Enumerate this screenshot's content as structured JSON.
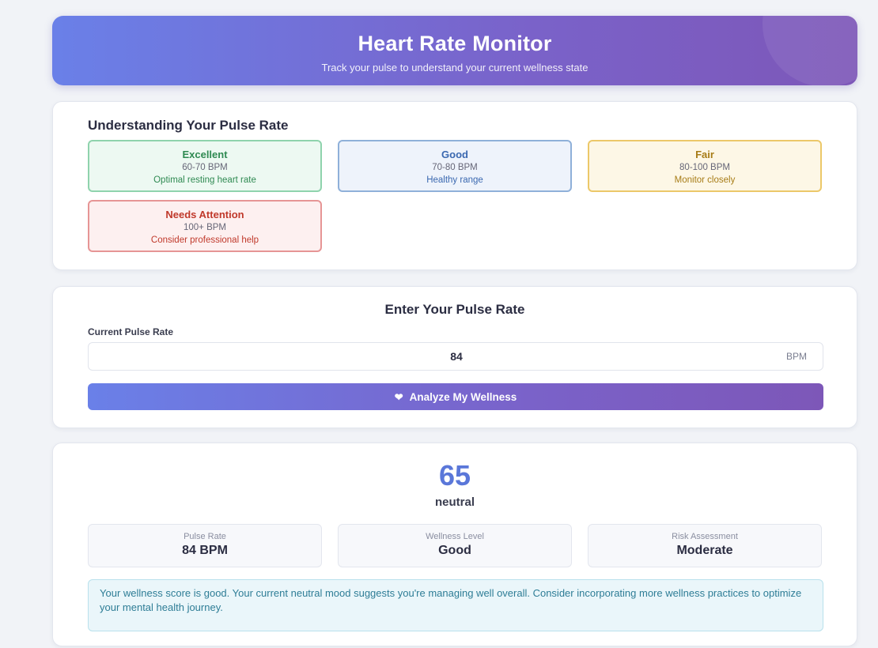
{
  "header": {
    "title": "Heart Rate Monitor",
    "subtitle": "Track your pulse to understand your current wellness state"
  },
  "understanding": {
    "title": "Understanding Your Pulse Rate",
    "ranges": [
      {
        "name": "Excellent",
        "bpm": "60-70 BPM",
        "description": "Optimal resting heart rate"
      },
      {
        "name": "Good",
        "bpm": "70-80 BPM",
        "description": "Healthy range"
      },
      {
        "name": "Fair",
        "bpm": "80-100 BPM",
        "description": "Monitor closely"
      },
      {
        "name": "Needs Attention",
        "bpm": "100+ BPM",
        "description": "Consider professional help"
      }
    ]
  },
  "entry": {
    "title": "Enter Your Pulse Rate",
    "field_label": "Current Pulse Rate",
    "value": "84",
    "unit": "BPM",
    "button_label": "Analyze My Wellness",
    "button_icon": "heart-icon"
  },
  "result": {
    "score": "65",
    "mood": "neutral",
    "metrics": [
      {
        "label": "Pulse Rate",
        "value": "84 BPM"
      },
      {
        "label": "Wellness Level",
        "value": "Good"
      },
      {
        "label": "Risk Assessment",
        "value": "Moderate"
      }
    ],
    "message": "Your wellness score is good. Your current neutral mood suggests you're managing well overall. Consider incorporating more wellness practices to optimize your mental health journey."
  },
  "colors": {
    "accent_start": "#6a80e8",
    "accent_end": "#7d57b8",
    "score": "#5a77d9",
    "excellent": "#2f8a52",
    "good": "#3a68b0",
    "fair": "#a77c16",
    "attention": "#c0392b",
    "message": "#2e7d96"
  }
}
